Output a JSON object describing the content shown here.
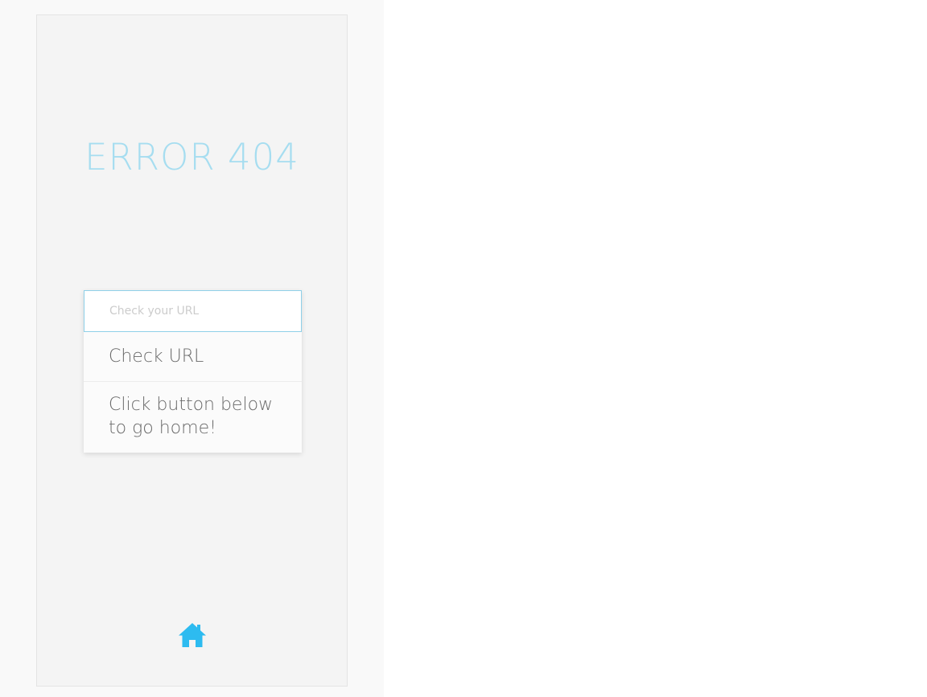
{
  "error": {
    "title": "ERROR 404"
  },
  "url_check": {
    "placeholder": "Check your URL",
    "value": "",
    "button_label": "Check URL"
  },
  "hint": {
    "text": "Click button below to go home!"
  },
  "home": {
    "icon": "home-icon",
    "color": "#2dbbf0"
  },
  "colors": {
    "accent": "#a6ddf0",
    "input_border": "#8fd0e8",
    "icon": "#2dbbf0"
  }
}
